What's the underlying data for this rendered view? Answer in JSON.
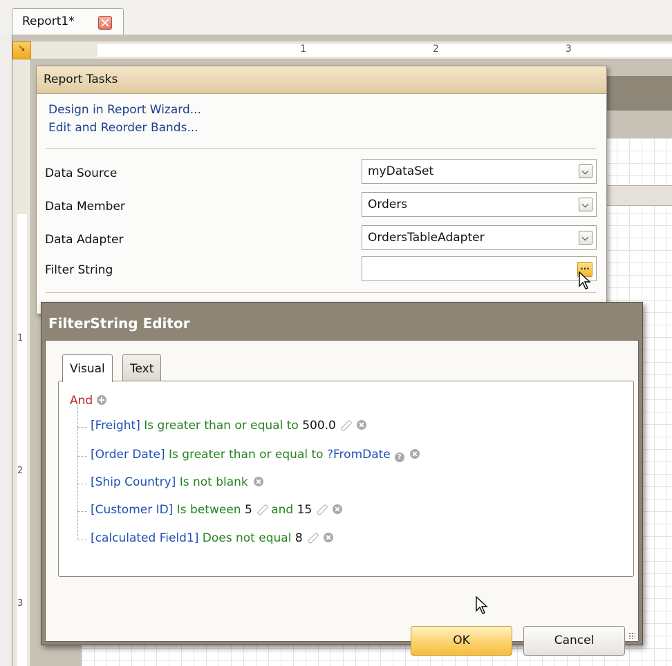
{
  "document_tab": {
    "label": "Report1*"
  },
  "ruler": {
    "h_numbers": [
      "1",
      "2",
      "3"
    ],
    "v_numbers": [
      "1",
      "2",
      "3"
    ]
  },
  "report_tasks": {
    "title": "Report Tasks",
    "links": [
      "Design in Report Wizard...",
      "Edit and Reorder Bands..."
    ],
    "properties": [
      {
        "label": "Data Source",
        "value": "myDataSet",
        "button": "dropdown"
      },
      {
        "label": "Data Member",
        "value": "Orders",
        "button": "dropdown"
      },
      {
        "label": "Data Adapter",
        "value": "OrdersTableAdapter",
        "button": "dropdown"
      },
      {
        "label": "Filter String",
        "value": "",
        "button": "ellipsis",
        "button_label": "..."
      }
    ]
  },
  "filter_editor": {
    "title": "FilterString Editor",
    "tabs": [
      "Visual",
      "Text"
    ],
    "active_tab": "Visual",
    "root_operator": "And",
    "conditions": [
      {
        "field": "[Freight]",
        "operator": "Is greater than or equal to",
        "value": "500.0"
      },
      {
        "field": "[Order Date]",
        "operator": "Is greater than or equal to",
        "parameter": "?FromDate"
      },
      {
        "field": "[Ship Country]",
        "operator": "Is not blank"
      },
      {
        "field": "[Customer ID]",
        "operator": "Is between",
        "value": "5",
        "and_label": "and",
        "value2": "15"
      },
      {
        "field": "[calculated Field1]",
        "operator": "Does not equal",
        "value": "8"
      }
    ],
    "ok_label": "OK",
    "cancel_label": "Cancel"
  },
  "colors": {
    "link": "#1f3f8f",
    "field": "#1d50b8",
    "operator": "#24841f",
    "group_keyword": "#b8232a",
    "dialog_title_bar": "#8f8576",
    "ok_button": "#fbd36f"
  }
}
